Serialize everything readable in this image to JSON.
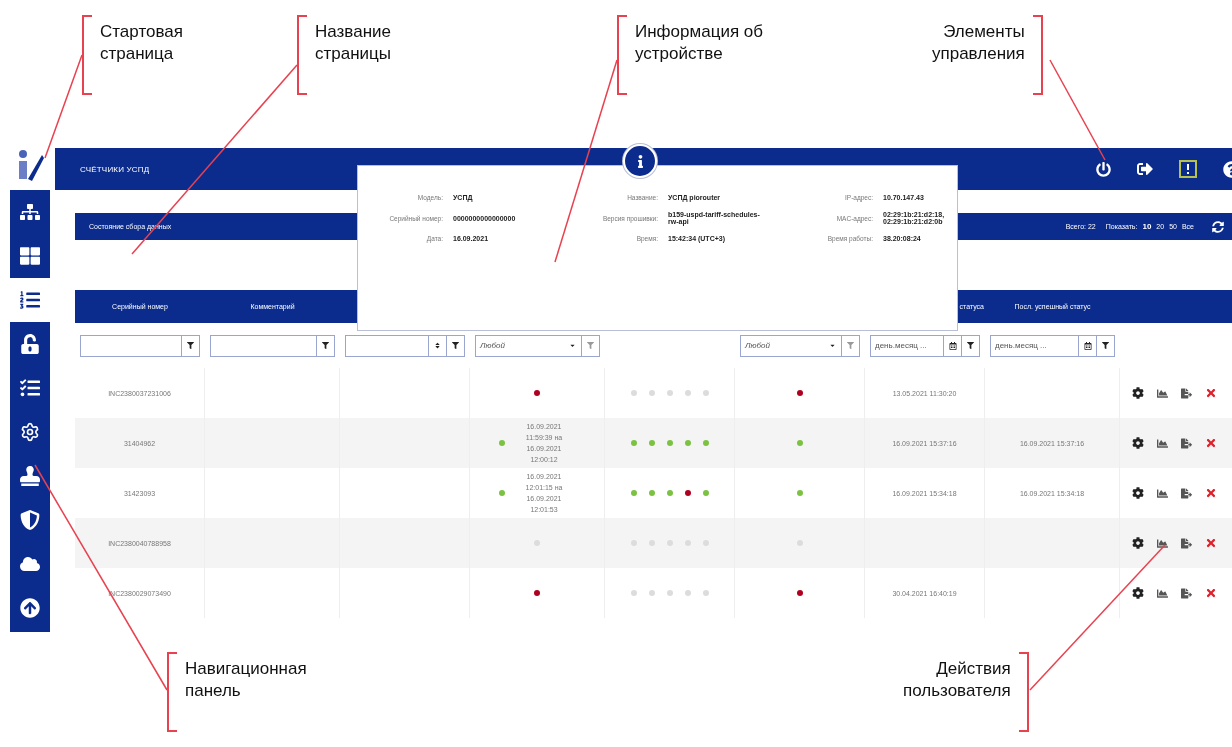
{
  "annotations": [
    {
      "text": "Стартовая\nстраница",
      "bracket_right": false
    },
    {
      "text": "Название\nстраницы",
      "bracket_right": false
    },
    {
      "text": "Информация об\nустройстве",
      "bracket_right": false
    },
    {
      "text": "Элементы\nуправления",
      "bracket_right": true
    },
    {
      "text": "Навигационная\nпанель",
      "bracket_right": false
    },
    {
      "text": "Действия\nпользователя",
      "bracket_right": true
    }
  ],
  "sidebar": {
    "items": [
      {
        "selected": false
      },
      {
        "selected": false
      },
      {
        "selected": true
      },
      {
        "selected": false
      },
      {
        "selected": false
      },
      {
        "selected": false
      },
      {
        "selected": false
      },
      {
        "selected": false
      },
      {
        "selected": false
      },
      {
        "selected": false
      }
    ]
  },
  "topbar": {
    "title": "СЧЁТЧИКИ УСПД"
  },
  "panel": {
    "title": "Состояние сбора данных",
    "total": "Всего: 22",
    "show_label": "Показать:",
    "page_sizes": [
      {
        "label": "10",
        "selected": true
      },
      {
        "label": "20",
        "selected": false
      },
      {
        "label": "50",
        "selected": false
      },
      {
        "label": "Все",
        "selected": false
      }
    ]
  },
  "device_info": {
    "fields": [
      {
        "label": "Модель:",
        "value": "УСПД"
      },
      {
        "label": "Название:",
        "value": "УСПД piorouter"
      },
      {
        "label": "IP-адрес:",
        "value": "10.70.147.43"
      },
      {
        "label": "Серийный номер:",
        "value": "0000000000000000"
      },
      {
        "label": "Версия прошивки:",
        "value": "b159-uspd-tariff-schedules-rw-api"
      },
      {
        "label": "MAC-адрес:",
        "value": "02:29:1b:21:d2:18, 02:29:1b:21:d2:0b"
      },
      {
        "label": "Дата:",
        "value": "16.09.2021"
      },
      {
        "label": "Время:",
        "value": "15:42:34 (UTC+3)"
      },
      {
        "label": "Время работы:",
        "value": "38.20:08:24"
      }
    ]
  },
  "table": {
    "columns": {
      "column_1": "Серийный номер",
      "column_2": "Комментарий",
      "column_7": "статуса",
      "column_8": "Посл. успешный статус"
    },
    "filters": [
      {
        "kind": "text"
      },
      {
        "kind": "text"
      },
      {
        "kind": "number"
      },
      {
        "kind": "select",
        "placeholder": "Любой"
      },
      {
        "kind": "none"
      },
      {
        "kind": "select",
        "placeholder": "Любой"
      },
      {
        "kind": "date",
        "placeholder": "день.месяц ..."
      },
      {
        "kind": "date",
        "placeholder": "день.месяц ..."
      },
      {
        "kind": "none"
      }
    ],
    "rows": [
      {
        "serial": "INC2380037231006",
        "column_4": {
          "color": "#b00020"
        },
        "column_5": [
          {
            "color": "#dcdcdc"
          },
          {
            "color": "#dcdcdc"
          },
          {
            "color": "#dcdcdc"
          },
          {
            "color": "#dcdcdc"
          },
          {
            "color": "#dcdcdc"
          }
        ],
        "column_6": {
          "color": "#b00020"
        },
        "column_7": "13.05.2021 11:30:20"
      },
      {
        "serial": "31404962",
        "column_4": {
          "color": "#7cc242",
          "text": "16.09.2021 11:59:39 на 16.09.2021 12:00:12"
        },
        "column_5": [
          {
            "color": "#7cc242"
          },
          {
            "color": "#7cc242"
          },
          {
            "color": "#7cc242"
          },
          {
            "color": "#7cc242"
          },
          {
            "color": "#7cc242"
          }
        ],
        "column_6": {
          "color": "#7cc242"
        },
        "column_7": "16.09.2021 15:37:16",
        "column_8": "16.09.2021 15:37:16"
      },
      {
        "serial": "31423093",
        "column_4": {
          "color": "#7cc242",
          "text": "16.09.2021 12:01:15 на 16.09.2021 12:01:53"
        },
        "column_5": [
          {
            "color": "#7cc242"
          },
          {
            "color": "#7cc242"
          },
          {
            "color": "#7cc242"
          },
          {
            "color": "#b00020"
          },
          {
            "color": "#7cc242"
          }
        ],
        "column_6": {
          "color": "#7cc242"
        },
        "column_7": "16.09.2021 15:34:18",
        "column_8": "16.09.2021 15:34:18"
      },
      {
        "serial": "INC2380040788958",
        "column_4": {
          "color": "#dcdcdc"
        },
        "column_5": [
          {
            "color": "#dcdcdc"
          },
          {
            "color": "#dcdcdc"
          },
          {
            "color": "#dcdcdc"
          },
          {
            "color": "#dcdcdc"
          },
          {
            "color": "#dcdcdc"
          }
        ],
        "column_6": {
          "color": "#dcdcdc"
        }
      },
      {
        "serial": "INC2380029073490",
        "column_4": {
          "color": "#b00020"
        },
        "column_5": [
          {
            "color": "#dcdcdc"
          },
          {
            "color": "#dcdcdc"
          },
          {
            "color": "#dcdcdc"
          },
          {
            "color": "#dcdcdc"
          },
          {
            "color": "#dcdcdc"
          }
        ],
        "column_6": {
          "color": "#b00020"
        },
        "column_7": "30.04.2021 16:40:19"
      }
    ]
  }
}
